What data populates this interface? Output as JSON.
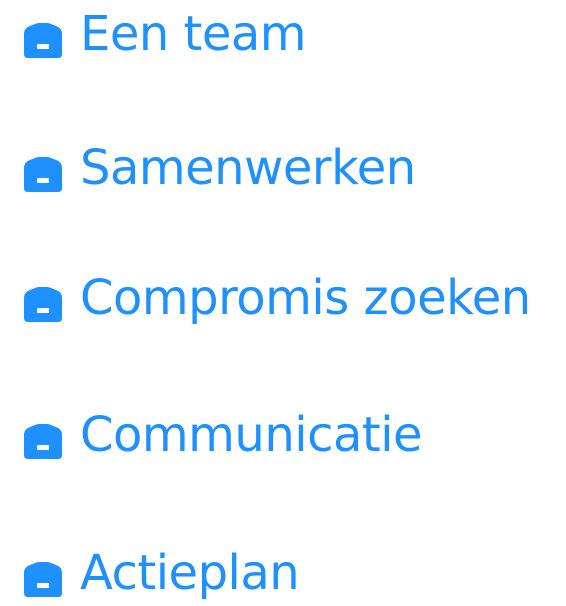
{
  "colors": {
    "link": "#1E90FF",
    "icon": "#1E90FF"
  },
  "links": [
    {
      "label": "Een team",
      "icon": "briefcase-icon"
    },
    {
      "label": "Samenwerken",
      "icon": "briefcase-icon"
    },
    {
      "label": "Compromis zoeken",
      "icon": "briefcase-icon"
    },
    {
      "label": "Communicatie",
      "icon": "briefcase-icon"
    },
    {
      "label": "Actieplan",
      "icon": "briefcase-icon"
    }
  ]
}
